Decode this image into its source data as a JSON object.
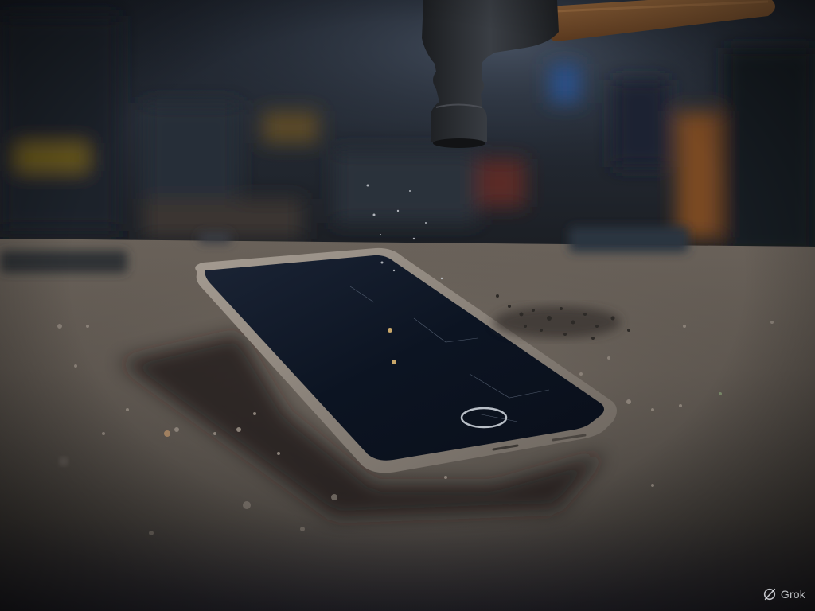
{
  "image": {
    "subject": "hammer-over-smartphone",
    "palette": {
      "background_dark": "#15181d",
      "table_surface": "#5e564e",
      "phone_screen": "#0c1422",
      "phone_frame": "#8d857d",
      "hammer_handle": "#7a4f2c",
      "hammer_head": "#2a2d31"
    }
  },
  "watermark": {
    "brand": "Grok",
    "icon": "grok-logo-icon"
  }
}
